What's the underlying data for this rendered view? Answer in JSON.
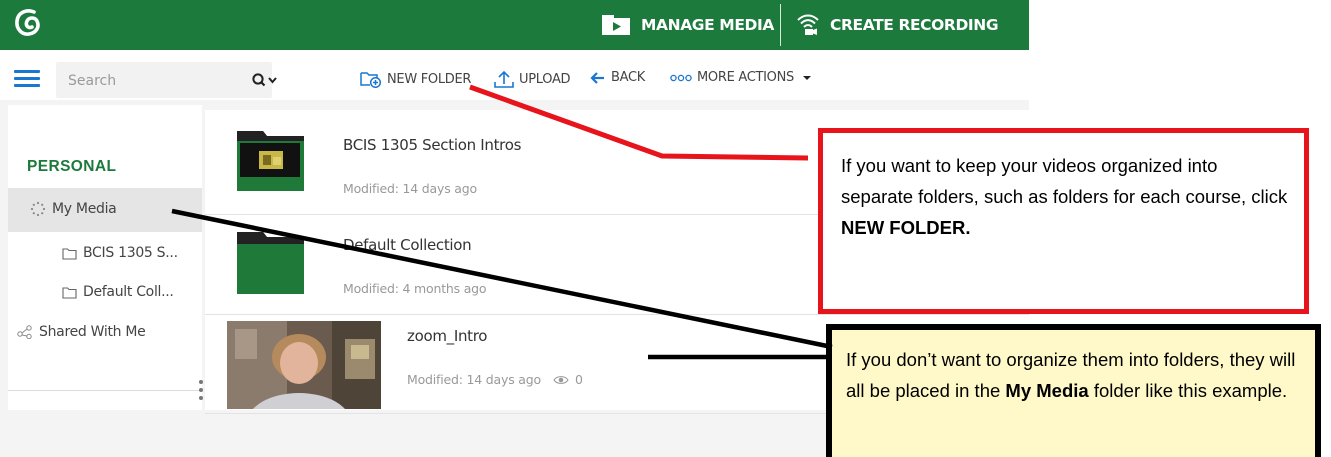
{
  "header": {
    "manage_media_label": "MANAGE MEDIA",
    "create_recording_label": "CREATE RECORDING",
    "brand_color": "#1c7a3c"
  },
  "toolbar": {
    "search_placeholder": "Search",
    "new_folder_label": "NEW FOLDER",
    "upload_label": "UPLOAD",
    "back_label": "BACK",
    "more_actions_label": "MORE ACTIONS",
    "accent_color": "#1976d2"
  },
  "sidebar": {
    "section_title": "PERSONAL",
    "items": [
      {
        "label": "My Media",
        "icon": "loader-icon",
        "selected": true
      },
      {
        "label": "BCIS 1305 S...",
        "icon": "folder-icon"
      },
      {
        "label": "Default Coll...",
        "icon": "folder-icon"
      },
      {
        "label": "Shared With Me",
        "icon": "share-icon"
      }
    ]
  },
  "media_list": [
    {
      "title": "BCIS 1305 Section Intros",
      "meta": "Modified: 14 days ago",
      "type": "folder"
    },
    {
      "title": "Default Collection",
      "meta": "Modified: 4 months ago",
      "type": "folder"
    },
    {
      "title": "zoom_Intro",
      "meta": "Modified: 14 days ago",
      "views": "0",
      "type": "video"
    }
  ],
  "annotations": {
    "new_folder_note": {
      "text": "If you want to keep your videos organized into separate folders, such as folders for each course, click ",
      "bold": "NEW FOLDER.",
      "border_color": "#e8141c"
    },
    "my_media_note": {
      "text_1": "If you don’t want to organize them into folders, they will all be placed in the ",
      "bold_1": "My Media",
      "text_2": " folder like this example.",
      "background_color": "#fff8c8"
    }
  }
}
